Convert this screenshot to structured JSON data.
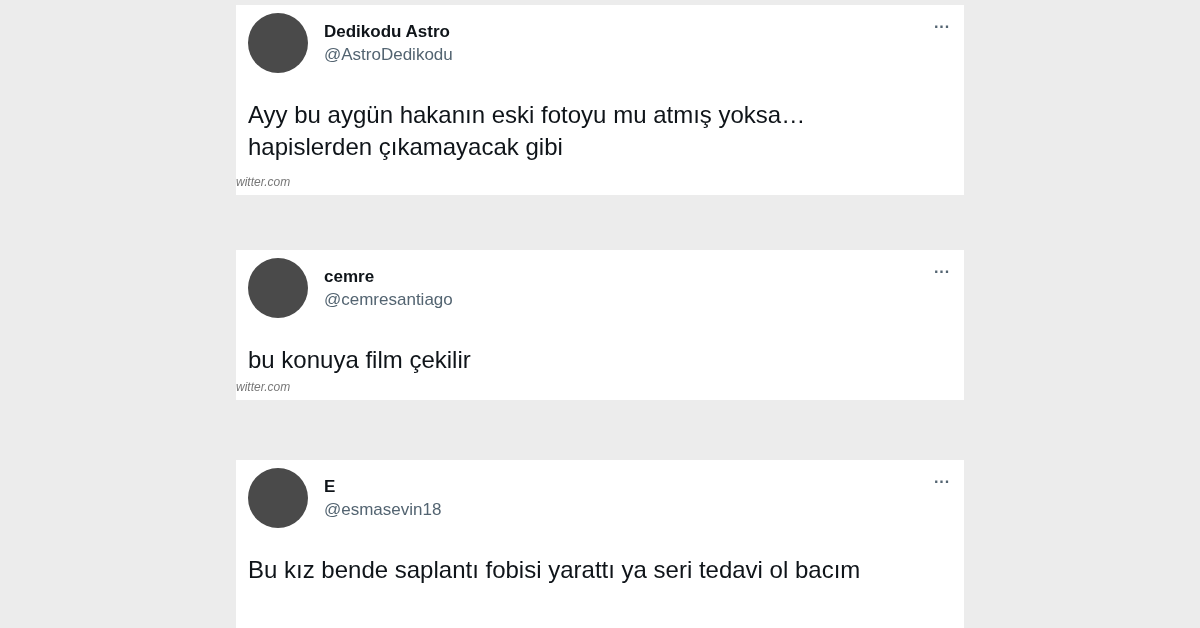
{
  "tweets": [
    {
      "name": "Dedikodu Astro",
      "handle": "@AstroDedikodu",
      "more": "···",
      "text": "Ayy bu aygün hakanın eski fotoyu mu atmış yoksa… hapislerden çıkamayacak gibi",
      "source": "witter.com"
    },
    {
      "name": "cemre",
      "handle": "@cemresantiago",
      "more": "···",
      "text": "bu konuya film çekilir",
      "source": "witter.com"
    },
    {
      "name": "E",
      "handle": "@esmasevin18",
      "more": "···",
      "text": "Bu kız bende saplantı fobisi yarattı ya seri tedavi ol bacım"
    }
  ]
}
